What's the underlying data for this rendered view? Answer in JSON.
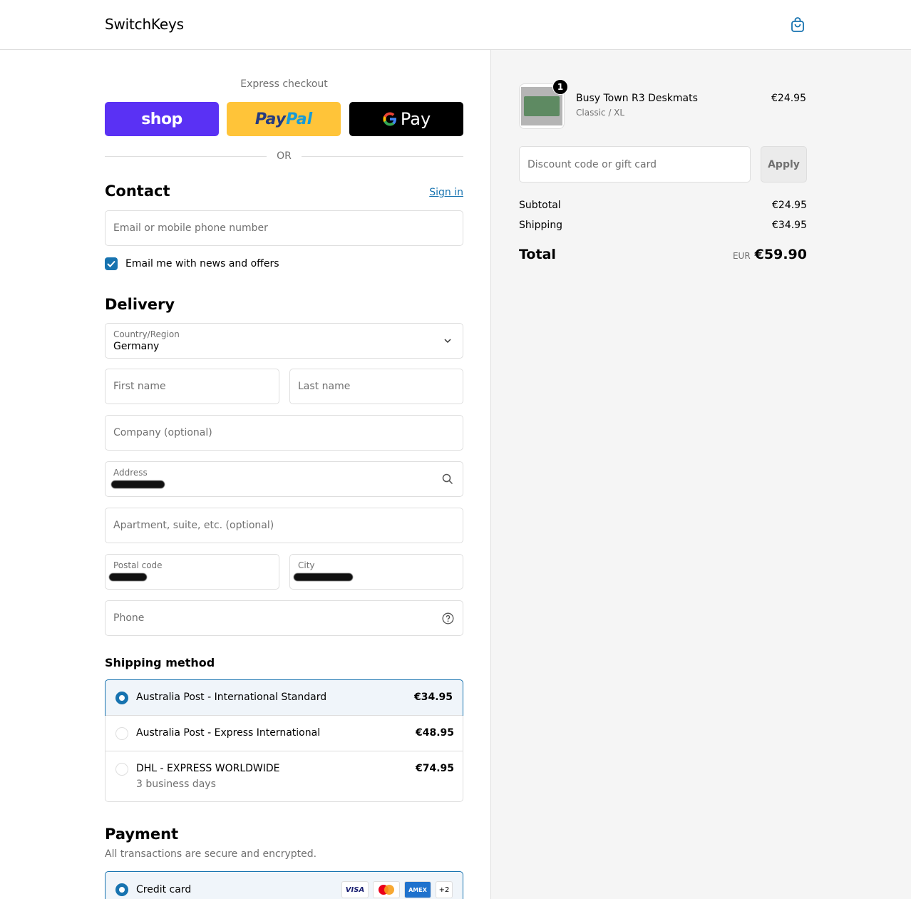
{
  "header": {
    "brand": "SwitchKeys",
    "cart_icon": "shopping-bag-icon"
  },
  "express": {
    "title": "Express checkout",
    "shop_label": "shop",
    "paypal_part1": "Pay",
    "paypal_part2": "Pal",
    "gpay_label": "Pay",
    "or_label": "OR"
  },
  "contact": {
    "title": "Contact",
    "signin_label": "Sign in",
    "email_placeholder": "Email or mobile phone number",
    "news_checkbox_label": "Email me with news and offers",
    "news_checked": true
  },
  "delivery": {
    "title": "Delivery",
    "country_label": "Country/Region",
    "country_value": "Germany",
    "first_name_placeholder": "First name",
    "last_name_placeholder": "Last name",
    "company_placeholder": "Company (optional)",
    "address_label": "Address",
    "apartment_placeholder": "Apartment, suite, etc. (optional)",
    "postal_label": "Postal code",
    "city_label": "City",
    "phone_placeholder": "Phone"
  },
  "shipping": {
    "title": "Shipping method",
    "options": [
      {
        "name": "Australia Post - International Standard",
        "price": "€34.95",
        "selected": true
      },
      {
        "name": "Australia Post - Express International",
        "price": "€48.95",
        "selected": false
      },
      {
        "name": "DHL - EXPRESS WORLDWIDE",
        "sub": "3 business days",
        "price": "€74.95",
        "selected": false
      }
    ]
  },
  "payment": {
    "title": "Payment",
    "subtitle": "All transactions are secure and encrypted.",
    "method": "Credit card",
    "cards": [
      "VISA",
      "AMEX"
    ],
    "more_cards": "+2"
  },
  "summary": {
    "item": {
      "name": "Busy Town R3 Deskmats",
      "variant": "Classic / XL",
      "price": "€24.95",
      "quantity": "1"
    },
    "discount_placeholder": "Discount code or gift card",
    "apply_label": "Apply",
    "subtotal_label": "Subtotal",
    "subtotal_value": "€24.95",
    "shipping_label": "Shipping",
    "shipping_value": "€34.95",
    "total_label": "Total",
    "currency": "EUR",
    "total_value": "€59.90"
  },
  "colors": {
    "accent": "#1773b0",
    "shop": "#5a31f4",
    "paypal": "#ffc439",
    "gpay": "#000000"
  }
}
